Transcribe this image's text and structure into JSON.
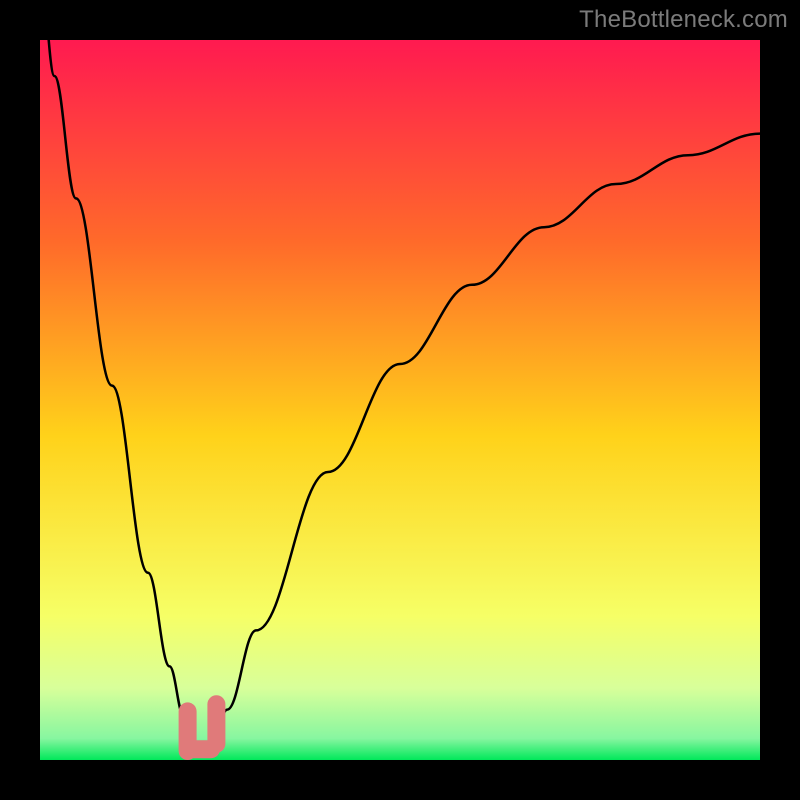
{
  "watermark": "TheBottleneck.com",
  "colors": {
    "bg": "#000000",
    "grad_top": "#ff1a50",
    "grad_mid1": "#ff6a2a",
    "grad_mid2": "#ffd21a",
    "grad_mid3": "#f6ff66",
    "grad_mid4": "#d8ff9a",
    "grad_bottom": "#00e85a",
    "curve": "#000000",
    "marker": "#e07a7a"
  },
  "chart_data": {
    "type": "line",
    "title": "",
    "xlabel": "",
    "ylabel": "",
    "xlim": [
      0,
      100
    ],
    "ylim": [
      0,
      100
    ],
    "series": [
      {
        "name": "bottleneck-curve",
        "x": [
          0,
          2,
          5,
          10,
          15,
          18,
          20,
          21,
          22,
          23,
          24,
          26,
          30,
          40,
          50,
          60,
          70,
          80,
          90,
          100
        ],
        "y": [
          110,
          95,
          78,
          52,
          26,
          13,
          6,
          3,
          2,
          2,
          3,
          7,
          18,
          40,
          55,
          66,
          74,
          80,
          84,
          87
        ]
      }
    ],
    "markers": [
      {
        "name": "marker-left",
        "x": 20.5,
        "y": 4,
        "width": 2.5,
        "height": 8
      },
      {
        "name": "marker-right",
        "x": 24.5,
        "y": 5,
        "width": 2.5,
        "height": 8
      },
      {
        "name": "marker-bottom",
        "x": 22.5,
        "y": 1.5,
        "width": 5,
        "height": 2.5
      }
    ],
    "optimal_x": 22
  }
}
